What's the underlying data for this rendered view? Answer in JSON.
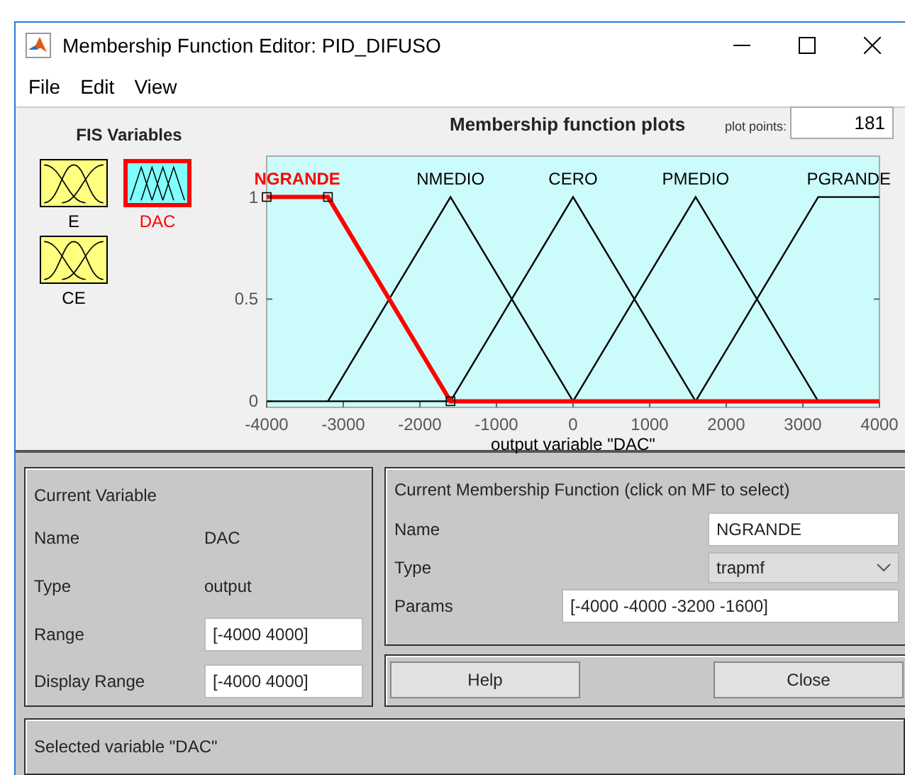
{
  "window": {
    "title": "Membership Function Editor: PID_DIFUSO"
  },
  "menu": [
    "File",
    "Edit",
    "View"
  ],
  "fis_variables": {
    "heading": "FIS Variables",
    "items": [
      {
        "name": "E",
        "kind": "input",
        "selected": false
      },
      {
        "name": "DAC",
        "kind": "output",
        "selected": true
      },
      {
        "name": "CE",
        "kind": "input",
        "selected": false
      }
    ]
  },
  "plot_points": {
    "label": "plot points:",
    "value": "181"
  },
  "plot": {
    "chart_data": {
      "type": "line",
      "title": "Membership function plots",
      "xlabel": "output variable \"DAC\"",
      "x": [
        -4000,
        -3200,
        -2400,
        -1600,
        -800,
        0,
        800,
        1600,
        2400,
        3200,
        4000
      ],
      "xlim": [
        -4000,
        4000
      ],
      "ylim": [
        -0.03,
        1.2
      ],
      "xticks": [
        -4000,
        -3000,
        -2000,
        -1000,
        0,
        1000,
        2000,
        3000,
        4000
      ],
      "yticks": [
        0,
        0.5,
        1
      ],
      "series": [
        {
          "name": "NMEDIO",
          "color": "#000000",
          "values": [
            null,
            0,
            0.5,
            1,
            0.5,
            0,
            null,
            null,
            null,
            null,
            null
          ]
        },
        {
          "name": "CERO",
          "color": "#000000",
          "values": [
            null,
            null,
            null,
            0,
            0.5,
            1,
            0.5,
            0,
            null,
            null,
            null
          ]
        },
        {
          "name": "PMEDIO",
          "color": "#000000",
          "values": [
            null,
            null,
            null,
            null,
            null,
            0,
            0.5,
            1,
            0.5,
            0,
            null
          ]
        },
        {
          "name": "PGRANDE",
          "color": "#000000",
          "values": [
            null,
            null,
            null,
            null,
            null,
            null,
            null,
            0,
            0.5,
            1,
            1
          ]
        },
        {
          "name": "NGRANDE",
          "color": "#ff0000",
          "values": [
            1,
            1,
            0.5,
            0,
            0,
            0,
            0,
            0,
            0,
            0,
            0
          ]
        }
      ]
    },
    "curves": [
      {
        "selected": false
      },
      {
        "selected": false
      },
      {
        "selected": false
      },
      {
        "selected": false
      },
      {
        "selected": true
      }
    ]
  },
  "current_variable": {
    "title": "Current Variable",
    "name_label": "Name",
    "name": "DAC",
    "type_label": "Type",
    "type": "output",
    "range_label": "Range",
    "range": "[-4000 4000]",
    "display_range_label": "Display Range",
    "display_range": "[-4000 4000]"
  },
  "current_mf": {
    "title": "Current Membership Function (click on MF to select)",
    "name_label": "Name",
    "name": "NGRANDE",
    "type_label": "Type",
    "type": "trapmf",
    "params_label": "Params",
    "params": "[-4000 -4000 -3200 -1600]"
  },
  "buttons": [
    "Help",
    "Close"
  ],
  "status_bar": "Selected variable \"DAC\""
}
